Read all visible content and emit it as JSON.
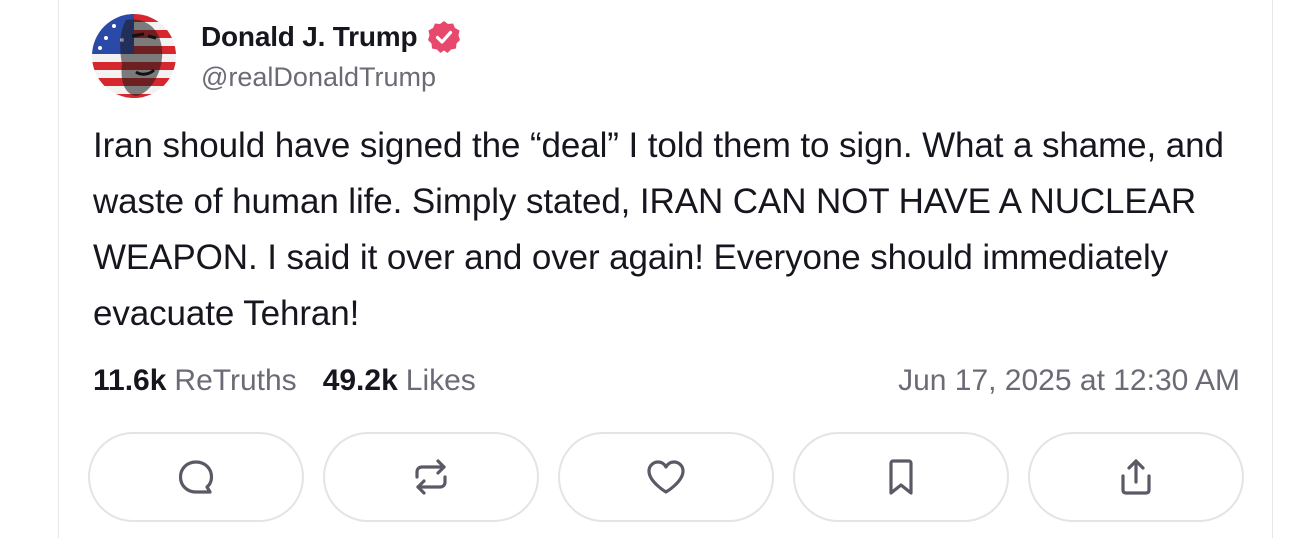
{
  "author": {
    "display_name": "Donald J. Trump",
    "handle": "@realDonaldTrump",
    "verified": true,
    "verified_color": "#e8486c"
  },
  "post": {
    "text": "Iran should have signed the “deal” I told them to sign. What a shame, and waste of human life. Simply stated, IRAN CAN NOT HAVE A NUCLEAR WEAPON. I said it over and over again! Everyone should immediately evacuate Tehran!",
    "retruths_count": "11.6k",
    "retruths_label": "ReTruths",
    "likes_count": "49.2k",
    "likes_label": "Likes",
    "timestamp": "Jun 17, 2025 at 12:30 AM"
  },
  "actions": [
    {
      "name": "reply",
      "icon": "comment-icon"
    },
    {
      "name": "retruth",
      "icon": "repost-icon"
    },
    {
      "name": "like",
      "icon": "heart-icon"
    },
    {
      "name": "bookmark",
      "icon": "bookmark-icon"
    },
    {
      "name": "share",
      "icon": "share-icon"
    }
  ],
  "colors": {
    "text_primary": "#16161f",
    "text_secondary": "#6b6b76",
    "border": "#e4e4e8",
    "icon": "#5a5a66"
  }
}
